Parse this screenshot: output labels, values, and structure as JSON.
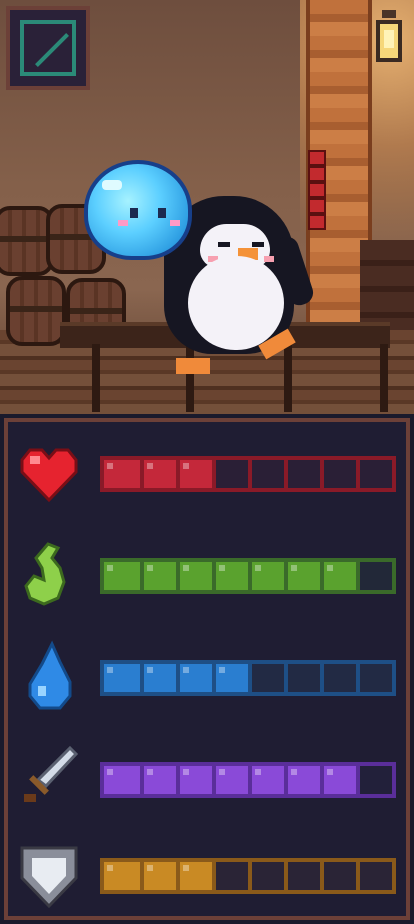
{
  "scene": {
    "characters": [
      "penguin",
      "slime"
    ],
    "props": [
      "barrels",
      "lantern",
      "wooden-pillar",
      "table"
    ]
  },
  "menu_button": {
    "icon": "frame-icon",
    "accent": "#2b8a78"
  },
  "stats": [
    {
      "id": "health",
      "icon": "heart-icon",
      "filled": 3,
      "total": 8,
      "color": "#c4283a",
      "empty": "#2a1f36",
      "border": "#8a1a28"
    },
    {
      "id": "stamina",
      "icon": "flame-icon",
      "filled": 7,
      "total": 8,
      "color": "#5aa22e",
      "empty": "#222838",
      "border": "#3a6a2a"
    },
    {
      "id": "mana",
      "icon": "water-drop-icon",
      "filled": 4,
      "total": 8,
      "color": "#2a7ed0",
      "empty": "#222a44",
      "border": "#1e4f86"
    },
    {
      "id": "attack",
      "icon": "sword-icon",
      "filled": 7,
      "total": 8,
      "color": "#8a4ad8",
      "empty": "#22203a",
      "border": "#5a2e9a"
    },
    {
      "id": "defense",
      "icon": "shield-icon",
      "filled": 3,
      "total": 8,
      "color": "#c98a24",
      "empty": "#2a2436",
      "border": "#8a5a1a"
    }
  ]
}
